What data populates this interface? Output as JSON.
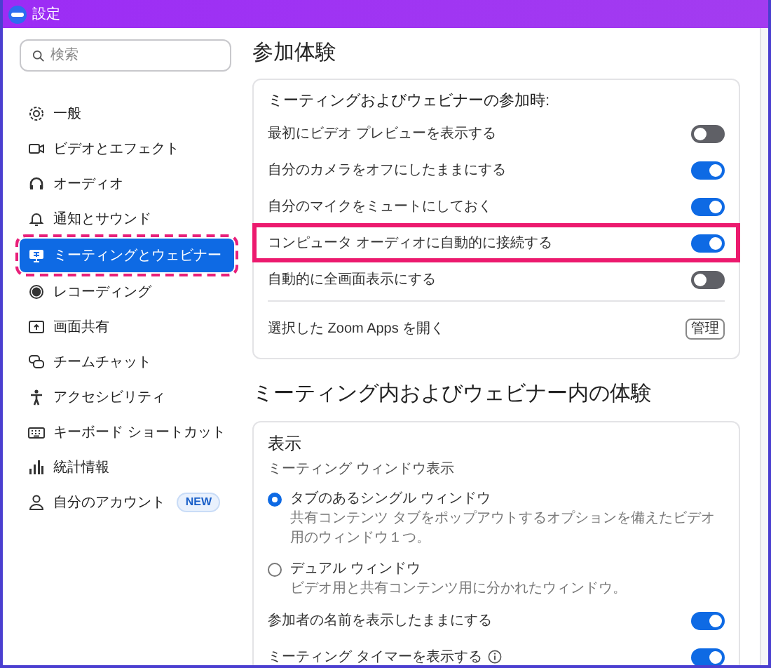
{
  "window": {
    "title": "設定"
  },
  "search": {
    "placeholder": "検索"
  },
  "sidebar": {
    "items": [
      {
        "label": "一般",
        "selected": false
      },
      {
        "label": "ビデオとエフェクト",
        "selected": false
      },
      {
        "label": "オーディオ",
        "selected": false
      },
      {
        "label": "通知とサウンド",
        "selected": false
      },
      {
        "label": "ミーティングとウェビナー",
        "selected": true
      },
      {
        "label": "レコーディング",
        "selected": false
      },
      {
        "label": "画面共有",
        "selected": false
      },
      {
        "label": "チームチャット",
        "selected": false
      },
      {
        "label": "アクセシビリティ",
        "selected": false
      },
      {
        "label": "キーボード ショートカット",
        "selected": false
      },
      {
        "label": "統計情報",
        "selected": false
      },
      {
        "label": "自分のアカウント",
        "selected": false,
        "badge": "NEW"
      }
    ]
  },
  "sections": [
    {
      "title": "参加体験",
      "cards": [
        {
          "heading": "ミーティングおよびウェビナーの参加時:",
          "rows": [
            {
              "kind": "toggle",
              "label": "最初にビデオ プレビューを表示する",
              "on": false,
              "highlighted": false
            },
            {
              "kind": "toggle",
              "label": "自分のカメラをオフにしたままにする",
              "on": true,
              "highlighted": false
            },
            {
              "kind": "toggle",
              "label": "自分のマイクをミュートにしておく",
              "on": true,
              "highlighted": false
            },
            {
              "kind": "toggle",
              "label": "コンピュータ オーディオに自動的に接続する",
              "on": true,
              "highlighted": true
            },
            {
              "kind": "toggle",
              "label": "自動的に全画面表示にする",
              "on": false,
              "highlighted": false
            },
            {
              "kind": "divider"
            },
            {
              "kind": "button",
              "label": "選択した Zoom Apps を開く",
              "button": "管理"
            }
          ]
        }
      ]
    },
    {
      "title": "ミーティング内およびウェビナー内の体験",
      "cards": [
        {
          "heading": "表示",
          "rows": [
            {
              "kind": "caption",
              "label": "ミーティング ウィンドウ表示"
            },
            {
              "kind": "radio",
              "label": "タブのあるシングル ウィンドウ",
              "description": "共有コンテンツ タブをポップアウトするオプションを備えたビデオ用のウィンドウ１つ。",
              "selected": true
            },
            {
              "kind": "radio",
              "label": "デュアル ウィンドウ",
              "description": "ビデオ用と共有コンテンツ用に分かれたウィンドウ。",
              "selected": false
            },
            {
              "kind": "toggle",
              "label": "参加者の名前を表示したままにする",
              "on": true,
              "highlighted": false
            },
            {
              "kind": "toggle",
              "label": "ミーティング タイマーを表示する",
              "on": true,
              "highlighted": false,
              "info": true
            }
          ]
        }
      ]
    }
  ]
}
